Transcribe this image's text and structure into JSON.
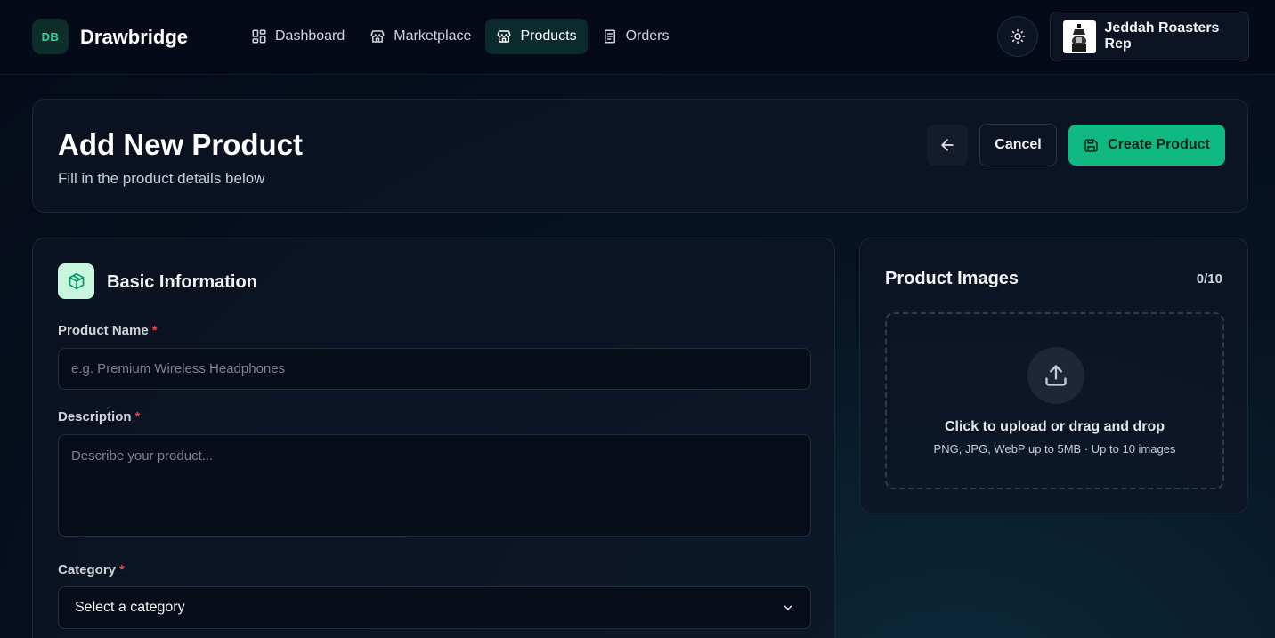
{
  "app": {
    "logo_initials": "DB",
    "brand": "Drawbridge"
  },
  "nav": {
    "items": [
      {
        "label": "Dashboard",
        "icon": "dashboard-icon",
        "active": false
      },
      {
        "label": "Marketplace",
        "icon": "store-icon",
        "active": false
      },
      {
        "label": "Products",
        "icon": "store-icon",
        "active": true
      },
      {
        "label": "Orders",
        "icon": "document-icon",
        "active": false
      }
    ]
  },
  "user": {
    "name": "Jeddah Roasters Rep",
    "avatar_icon": "coffee-pot-icon"
  },
  "header": {
    "title": "Add New Product",
    "subtitle": "Fill in the product details below",
    "cancel_label": "Cancel",
    "create_label": "Create Product"
  },
  "basic_info": {
    "title": "Basic Information",
    "product_name": {
      "label": "Product Name",
      "required": "*",
      "value": "",
      "placeholder": "e.g. Premium Wireless Headphones"
    },
    "description": {
      "label": "Description",
      "required": "*",
      "value": "",
      "placeholder": "Describe your product..."
    },
    "category": {
      "label": "Category",
      "required": "*",
      "selected": "Select a category"
    }
  },
  "images": {
    "title": "Product Images",
    "count": "0/10",
    "upload_title": "Click to upload or drag and drop",
    "upload_hint": "PNG, JPG, WebP up to 5MB · Up to 10 images"
  },
  "colors": {
    "accent": "#10b981",
    "background": "#050a18",
    "required": "#ef4444"
  }
}
